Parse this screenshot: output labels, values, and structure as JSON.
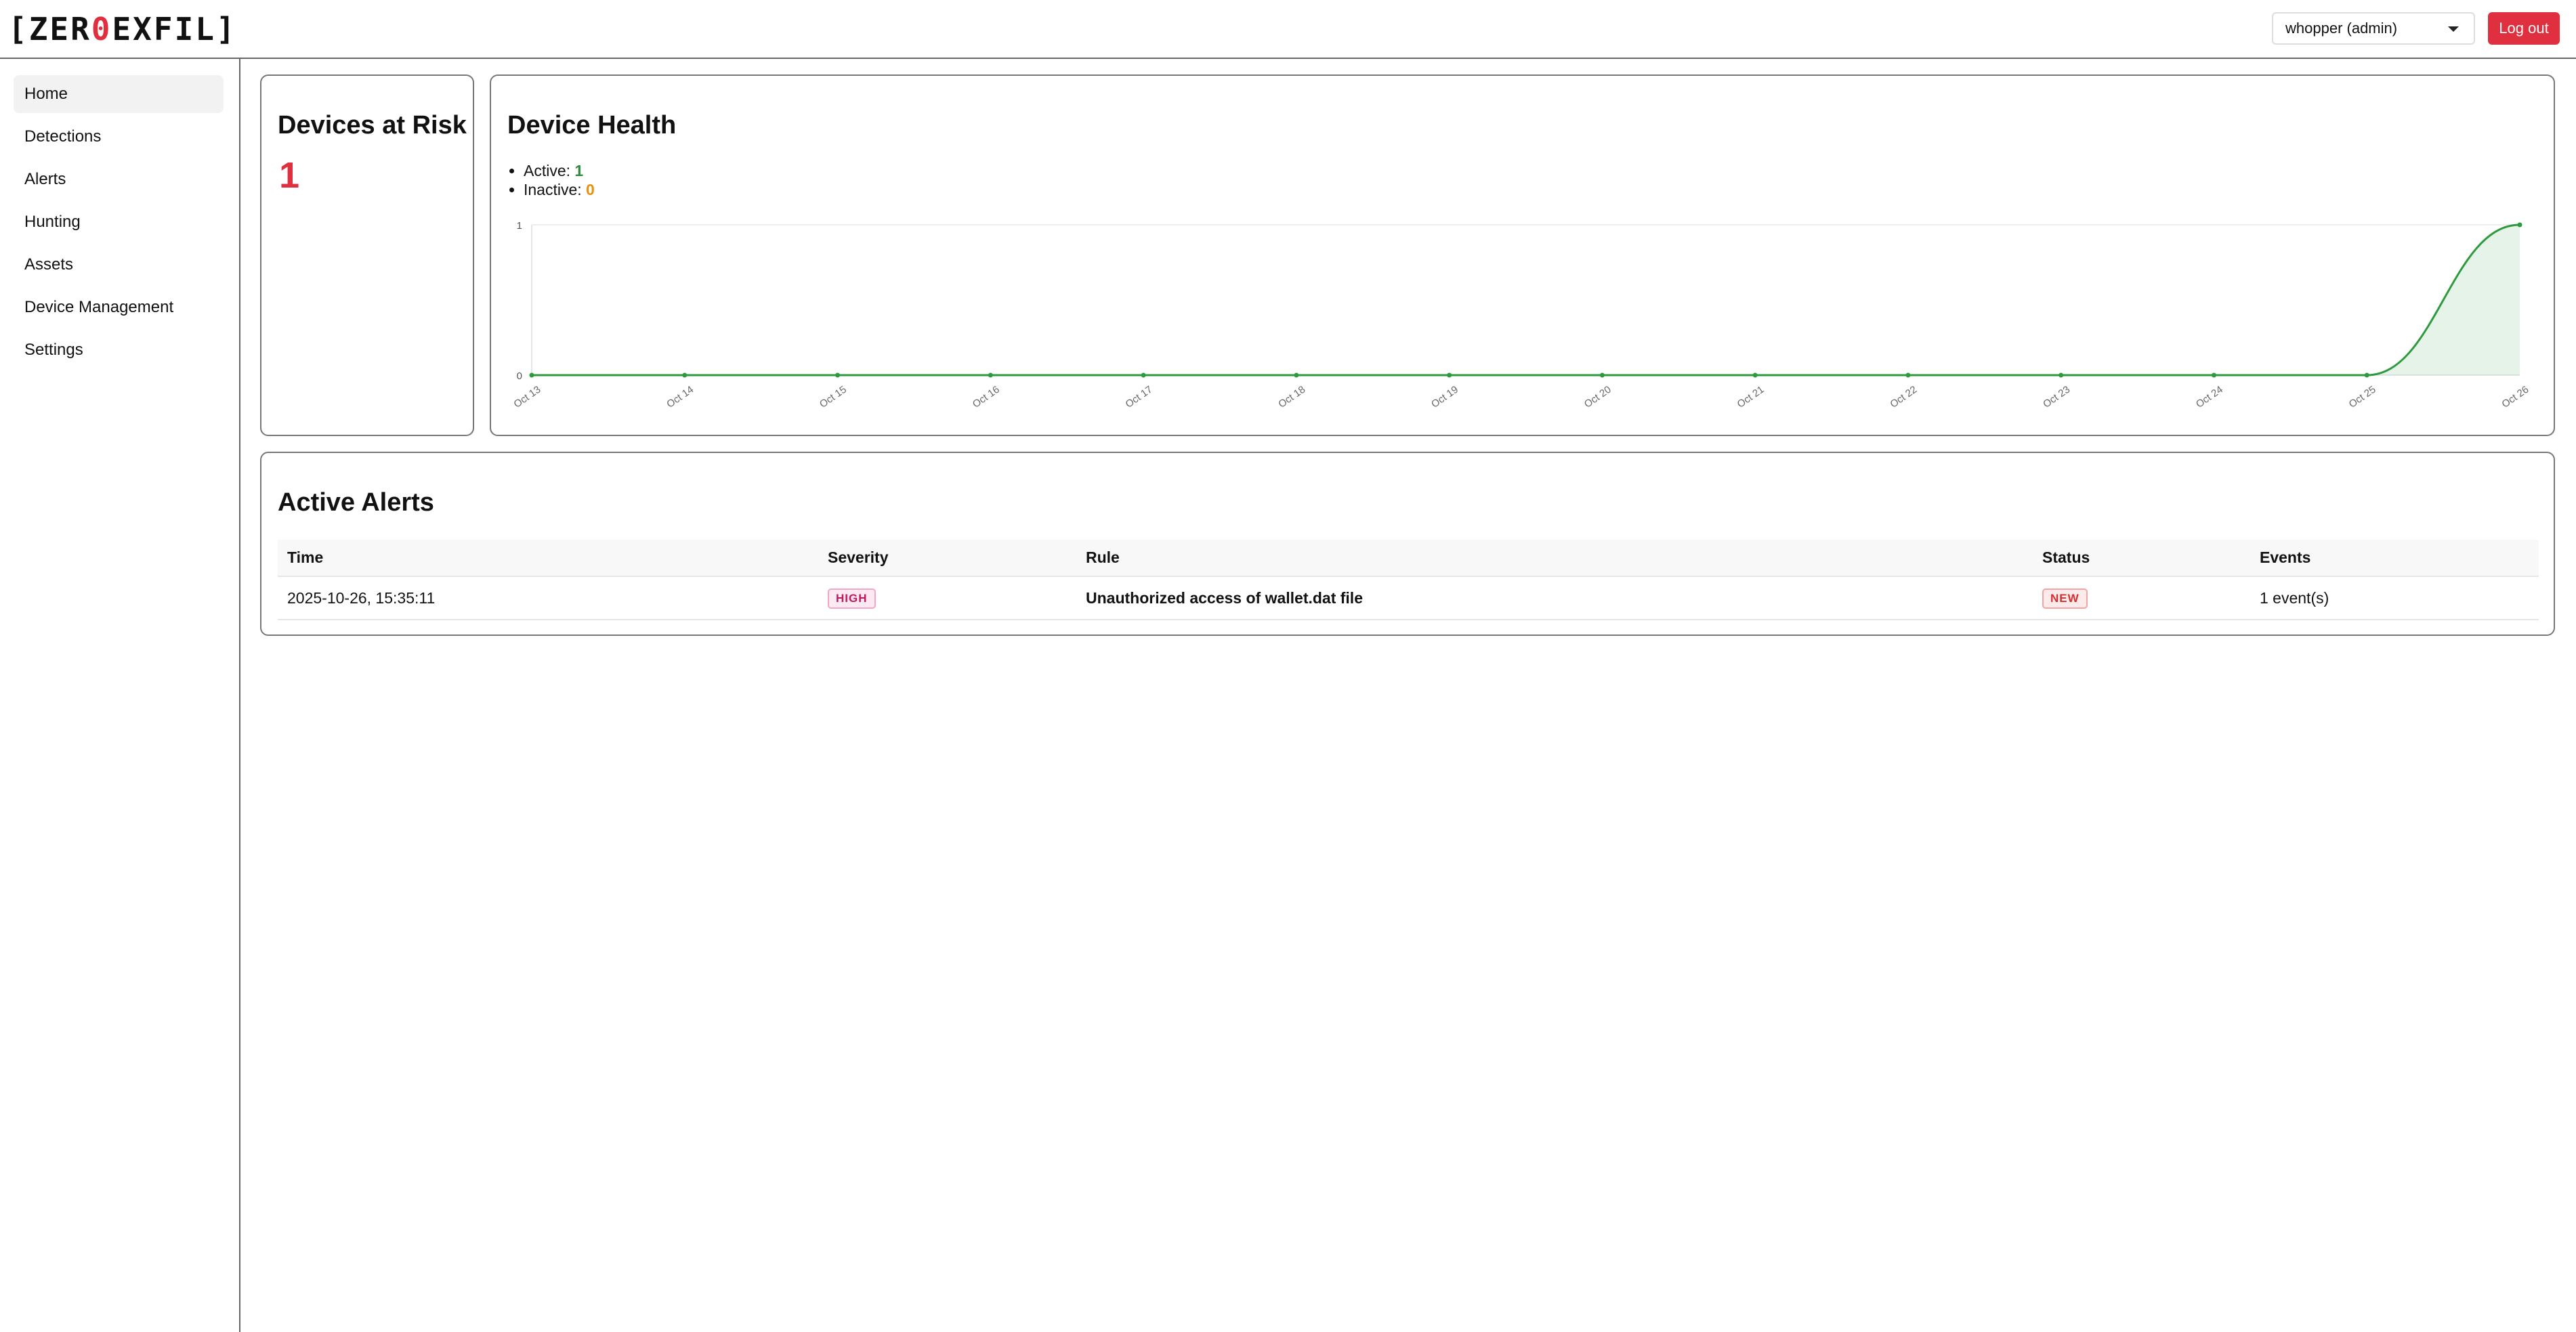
{
  "header": {
    "logo_prefix": "[ZER",
    "logo_zero": "0",
    "logo_suffix": "EXFIL]",
    "user_selected": "whopper (admin)",
    "logout_label": "Log out"
  },
  "sidebar": {
    "items": [
      {
        "label": "Home",
        "active": true
      },
      {
        "label": "Detections"
      },
      {
        "label": "Alerts"
      },
      {
        "label": "Hunting"
      },
      {
        "label": "Assets"
      },
      {
        "label": "Device Management"
      },
      {
        "label": "Settings"
      }
    ]
  },
  "devices_at_risk": {
    "title": "Devices at Risk",
    "value": "1"
  },
  "device_health": {
    "title": "Device Health",
    "active_label": "Active:",
    "active_value": "1",
    "inactive_label": "Inactive:",
    "inactive_value": "0"
  },
  "chart_data": {
    "type": "area",
    "title": "",
    "xlabel": "",
    "ylabel": "",
    "x": [
      "Oct 13",
      "Oct 14",
      "Oct 15",
      "Oct 16",
      "Oct 17",
      "Oct 18",
      "Oct 19",
      "Oct 20",
      "Oct 21",
      "Oct 22",
      "Oct 23",
      "Oct 24",
      "Oct 25",
      "Oct 26"
    ],
    "y_ticks": [
      "0",
      "1"
    ],
    "ylim": [
      0,
      1
    ],
    "grid": true,
    "series": [
      {
        "values": [
          0,
          0,
          0,
          0,
          0,
          0,
          0,
          0,
          0,
          0,
          0,
          0,
          0,
          1
        ],
        "color": "#2e9a3e"
      }
    ]
  },
  "active_alerts": {
    "title": "Active Alerts",
    "columns": [
      "Time",
      "Severity",
      "Rule",
      "Status",
      "Events"
    ],
    "rows": [
      {
        "time": "2025-10-26, 15:35:11",
        "severity": "HIGH",
        "rule": "Unauthorized access of wallet.dat file",
        "status": "NEW",
        "events": "1 event(s)"
      }
    ]
  },
  "colors": {
    "accent_red": "#e0303f",
    "active_green": "#2d8a3a",
    "inactive_orange": "#e8900c"
  }
}
